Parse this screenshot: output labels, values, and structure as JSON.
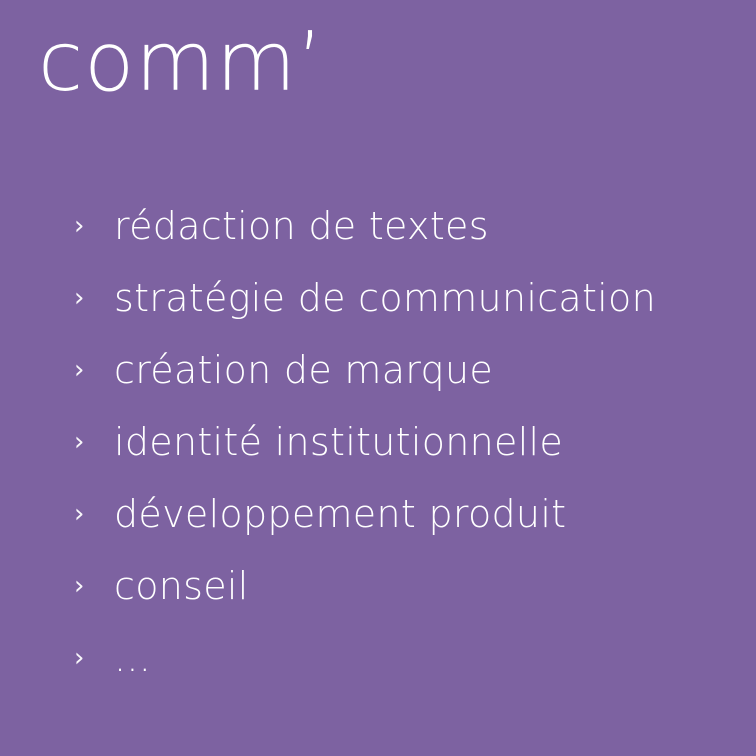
{
  "title": "comm’",
  "bullet_icon": "chevron-right-icon",
  "bullet_glyph": "›",
  "services": [
    {
      "label": "rédaction de textes"
    },
    {
      "label": "stratégie de communication"
    },
    {
      "label": "création de marque"
    },
    {
      "label": "identité institutionnelle"
    },
    {
      "label": "développement produit"
    },
    {
      "label": "conseil"
    },
    {
      "label": "..."
    }
  ],
  "colors": {
    "background": "#7d62a1",
    "text": "#ffffff"
  }
}
